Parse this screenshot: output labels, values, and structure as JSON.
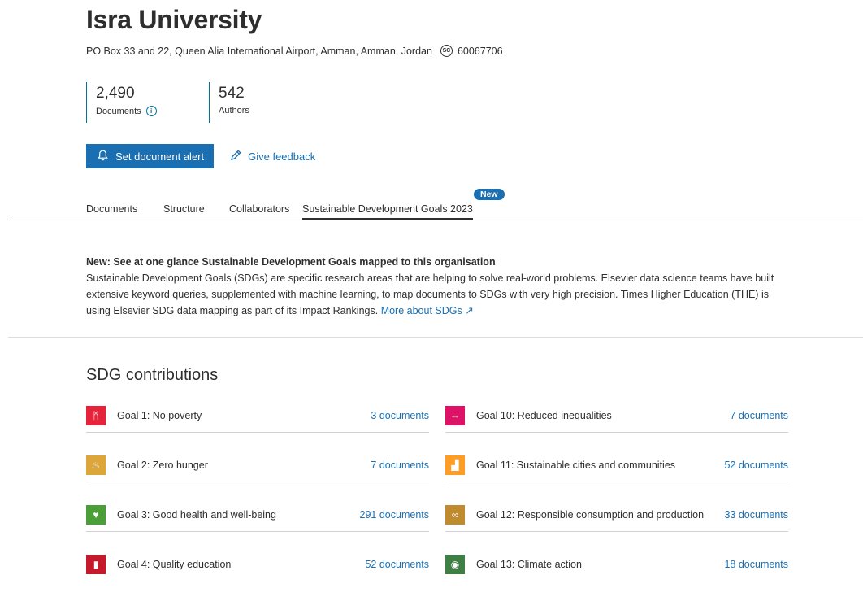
{
  "header": {
    "title": "Isra University",
    "address": "PO Box 33 and 22, Queen Alia International Airport, Amman, Amman, Jordan",
    "scopus_badge": "SC",
    "scopus_id": "60067706"
  },
  "metrics": {
    "documents_value": "2,490",
    "documents_label": "Documents",
    "info_glyph": "i",
    "authors_value": "542",
    "authors_label": "Authors"
  },
  "actions": {
    "alert_label": "Set document alert",
    "feedback_label": "Give feedback"
  },
  "tabs": {
    "items": [
      "Documents",
      "Structure",
      "Collaborators",
      "Sustainable Development Goals 2023"
    ],
    "new_badge": "New"
  },
  "intro": {
    "heading": "New: See at one glance Sustainable Development Goals mapped to this organisation",
    "body": "Sustainable Development Goals (SDGs) are specific research areas that are helping to solve real-world problems. Elsevier data science teams have built extensive keyword queries, supplemented with machine learning, to map documents to SDGs with very high precision. Times Higher Education (THE) is using Elsevier SDG data mapping as part of its Impact Rankings.",
    "link": "More about SDGs",
    "link_icon": "↗"
  },
  "sdg": {
    "title": "SDG contributions",
    "goals": [
      {
        "label": "Goal 1: No poverty",
        "docs": "3 documents",
        "color": "#e5243b",
        "icon": "people-icon",
        "glyph": "ᛗ"
      },
      {
        "label": "Goal 10: Reduced inequalities",
        "docs": "7 documents",
        "color": "#dd1367",
        "icon": "equality-icon",
        "glyph": "⇔"
      },
      {
        "label": "Goal 2: Zero hunger",
        "docs": "7 documents",
        "color": "#dda63a",
        "icon": "bowl-icon",
        "glyph": "♨"
      },
      {
        "label": "Goal 11: Sustainable cities and communities",
        "docs": "52 documents",
        "color": "#fd9d24",
        "icon": "city-icon",
        "glyph": "▟"
      },
      {
        "label": "Goal 3: Good health and well-being",
        "docs": "291 documents",
        "color": "#4c9f38",
        "icon": "heartbeat-icon",
        "glyph": "♥"
      },
      {
        "label": "Goal 12: Responsible consumption and production",
        "docs": "33 documents",
        "color": "#bf8b2e",
        "icon": "infinity-icon",
        "glyph": "∞"
      },
      {
        "label": "Goal 4: Quality education",
        "docs": "52 documents",
        "color": "#c5192d",
        "icon": "book-icon",
        "glyph": "▮"
      },
      {
        "label": "Goal 13: Climate action",
        "docs": "18 documents",
        "color": "#3f7e44",
        "icon": "eye-globe-icon",
        "glyph": "◉"
      }
    ]
  }
}
